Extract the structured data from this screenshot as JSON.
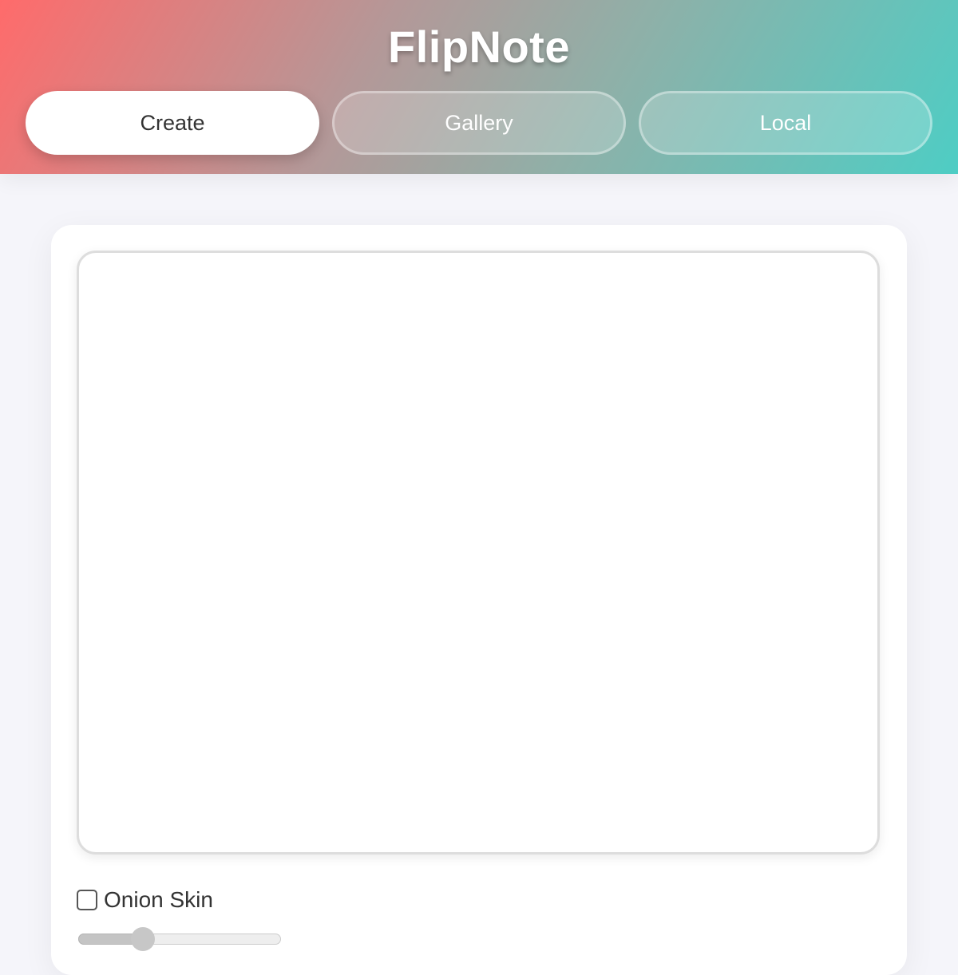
{
  "app": {
    "title": "FlipNote"
  },
  "tabs": [
    {
      "label": "Create",
      "active": true
    },
    {
      "label": "Gallery",
      "active": false
    },
    {
      "label": "Local",
      "active": false
    }
  ],
  "controls": {
    "onion_skin": {
      "label": "Onion Skin",
      "checked": false
    },
    "slider": {
      "value": 0.32
    }
  },
  "colors": {
    "header_gradient_start": "#ff6b6b",
    "header_gradient_end": "#4ecdc4",
    "page_background": "#f5f5fa"
  }
}
